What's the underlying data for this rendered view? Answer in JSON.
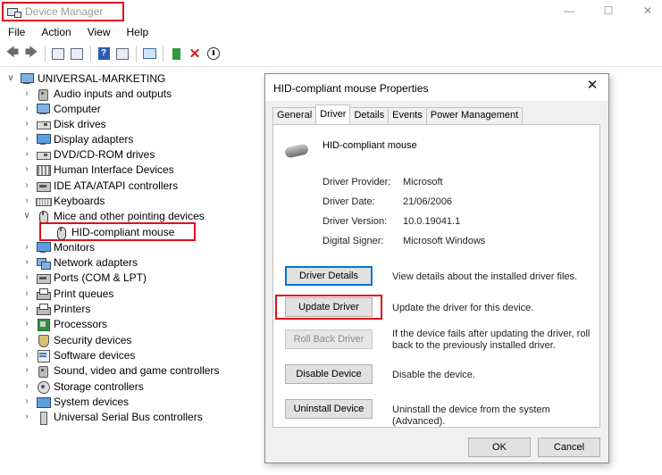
{
  "window": {
    "title": "Device Manager",
    "minimize_glyph": "—",
    "maximize_glyph": "☐",
    "close_glyph": "✕"
  },
  "menu": [
    "File",
    "Action",
    "View",
    "Help"
  ],
  "toolbar": {
    "icons": [
      "back-arrow-icon",
      "forward-arrow-icon",
      "properties-icon",
      "update-driver-icon",
      "help-icon",
      "view-icon",
      "monitor-icon",
      "add-device-icon",
      "uninstall-icon",
      "download-icon"
    ],
    "back_glyph": "🡄",
    "forward_glyph": "🡆",
    "help_glyph": "?",
    "uninstall_glyph": "✕",
    "download_glyph": "⬇"
  },
  "tree": {
    "root": "UNIVERSAL-MARKETING",
    "expand_glyph": "∨",
    "collapse_glyph": "›",
    "categories": [
      {
        "label": "Audio inputs and outputs",
        "icon": "speaker-icon"
      },
      {
        "label": "Computer",
        "icon": "computer-icon"
      },
      {
        "label": "Disk drives",
        "icon": "disk-drive-icon"
      },
      {
        "label": "Display adapters",
        "icon": "display-adapter-icon"
      },
      {
        "label": "DVD/CD-ROM drives",
        "icon": "dvd-drive-icon"
      },
      {
        "label": "Human Interface Devices",
        "icon": "hid-icon"
      },
      {
        "label": "IDE ATA/ATAPI controllers",
        "icon": "ide-controller-icon"
      },
      {
        "label": "Keyboards",
        "icon": "keyboard-icon"
      },
      {
        "label": "Mice and other pointing devices",
        "icon": "mouse-icon",
        "expanded": true,
        "children": [
          "HID-compliant mouse"
        ]
      },
      {
        "label": "Monitors",
        "icon": "monitor-icon"
      },
      {
        "label": "Network adapters",
        "icon": "network-adapter-icon"
      },
      {
        "label": "Ports (COM & LPT)",
        "icon": "port-icon"
      },
      {
        "label": "Print queues",
        "icon": "print-queue-icon"
      },
      {
        "label": "Printers",
        "icon": "printer-icon"
      },
      {
        "label": "Processors",
        "icon": "processor-icon"
      },
      {
        "label": "Security devices",
        "icon": "security-device-icon"
      },
      {
        "label": "Software devices",
        "icon": "software-device-icon"
      },
      {
        "label": "Sound, video and game controllers",
        "icon": "sound-controller-icon"
      },
      {
        "label": "Storage controllers",
        "icon": "storage-controller-icon"
      },
      {
        "label": "System devices",
        "icon": "system-device-icon"
      },
      {
        "label": "Universal Serial Bus controllers",
        "icon": "usb-icon"
      }
    ]
  },
  "dialog": {
    "title": "HID-compliant mouse Properties",
    "close_glyph": "✕",
    "tabs": [
      "General",
      "Driver",
      "Details",
      "Events",
      "Power Management"
    ],
    "active_tab": "Driver",
    "device_name": "HID-compliant mouse",
    "info": [
      {
        "label": "Driver Provider:",
        "value": "Microsoft"
      },
      {
        "label": "Driver Date:",
        "value": "21/06/2006"
      },
      {
        "label": "Driver Version:",
        "value": "10.0.19041.1"
      },
      {
        "label": "Digital Signer:",
        "value": "Microsoft Windows"
      }
    ],
    "actions": [
      {
        "button": "Driver Details",
        "description": "View details about the installed driver files."
      },
      {
        "button": "Update Driver",
        "description": "Update the driver for this device."
      },
      {
        "button": "Roll Back Driver",
        "description": "If the device fails after updating the driver, roll back to the previously installed driver."
      },
      {
        "button": "Disable Device",
        "description": "Disable the device."
      },
      {
        "button": "Uninstall Device",
        "description": "Uninstall the device from the system (Advanced)."
      }
    ],
    "ok_label": "OK",
    "cancel_label": "Cancel"
  },
  "colors": {
    "highlight_border": "#e0101a",
    "focus_border": "#0078d7"
  }
}
